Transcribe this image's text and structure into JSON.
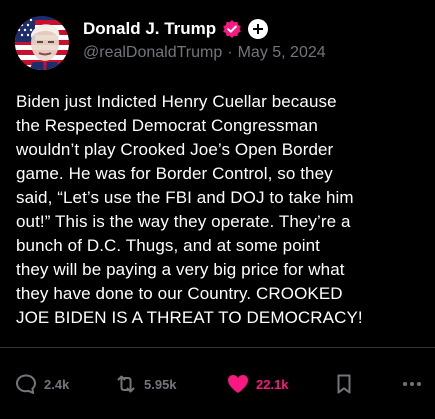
{
  "user": {
    "display_name": "Donald J. Trump",
    "handle": "@realDonaldTrump",
    "separator": "·",
    "date": "May 5, 2024",
    "verified_color": "#f91880"
  },
  "post": {
    "text": "Biden just Indicted Henry Cuellar because\nthe Respected Democrat Congressman\nwouldn’t play Crooked Joe’s Open Border\ngame. He was for Border Control, so they\nsaid, “Let’s use the FBI and DOJ to take him\nout!” This is the way they operate. They’re a\nbunch of D.C. Thugs, and at some point\nthey will be paying a very big price for what\nthey have done to our Country. CROOKED\nJOE BIDEN IS A THREAT TO DEMOCRACY!"
  },
  "actions": {
    "replies": "2.4k",
    "reposts": "5.95k",
    "likes": "22.1k",
    "like_color": "#f91880",
    "muted_color": "#71767b"
  }
}
